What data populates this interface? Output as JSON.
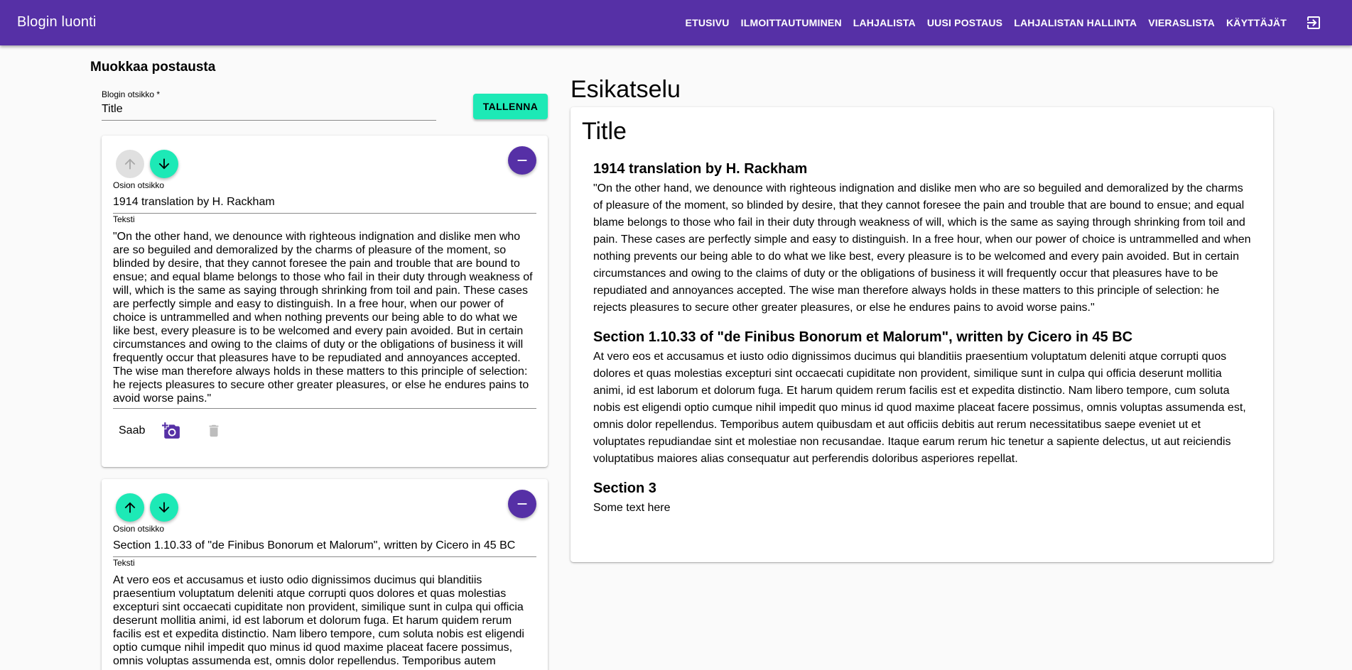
{
  "appbar": {
    "title": "Blogin luonti",
    "nav": [
      "ETUSIVU",
      "ILMOITTAUTUMINEN",
      "LAHJALISTA",
      "UUSI POSTAUS",
      "LAHJALISTAN HALLINTA",
      "VIERASLISTA",
      "KÄYTTÄJÄT"
    ],
    "logout_icon": "logout-icon"
  },
  "editor": {
    "heading": "Muokkaa postausta",
    "title_label": "Blogin otsikko *",
    "title_value": "Title",
    "save_label": "TALLENNA",
    "section_title_label": "Osion otsikko",
    "section_text_label": "Teksti",
    "image_button_label": "Saab",
    "sections": [
      {
        "title": "1914 translation by H. Rackham",
        "text": "\"On the other hand, we denounce with righteous indignation and dislike men who are so beguiled and demoralized by the charms of pleasure of the moment, so blinded by desire, that they cannot foresee the pain and trouble that are bound to ensue; and equal blame belongs to those who fail in their duty through weakness of will, which is the same as saying through shrinking from toil and pain. These cases are perfectly simple and easy to distinguish. In a free hour, when our power of choice is untrammelled and when nothing prevents our being able to do what we like best, every pleasure is to be welcomed and every pain avoided. But in certain circumstances and owing to the claims of duty or the obligations of business it will frequently occur that pleasures have to be repudiated and annoyances accepted. The wise man therefore always holds in these matters to this principle of selection: he rejects pleasures to secure other greater pleasures, or else he endures pains to avoid worse pains.\""
      },
      {
        "title": "Section 1.10.33 of \"de Finibus Bonorum et Malorum\", written by Cicero in 45 BC",
        "text": "At vero eos et accusamus et iusto odio dignissimos ducimus qui blanditiis praesentium voluptatum deleniti atque corrupti quos dolores et quas molestias excepturi sint occaecati cupiditate non provident, similique sunt in culpa qui officia deserunt mollitia animi, id est laborum et dolorum fuga. Et harum quidem rerum facilis est et expedita distinctio. Nam libero tempore, cum soluta nobis est eligendi optio cumque nihil impedit quo minus id quod maxime placeat facere possimus, omnis voluptas assumenda est, omnis dolor repellendus. Temporibus autem"
      }
    ]
  },
  "preview": {
    "heading": "Esikatselu",
    "title": "Title",
    "sections": [
      {
        "title": "1914 translation by H. Rackham",
        "text": "\"On the other hand, we denounce with righteous indignation and dislike men who are so beguiled and demoralized by the charms of pleasure of the moment, so blinded by desire, that they cannot foresee the pain and trouble that are bound to ensue; and equal blame belongs to those who fail in their duty through weakness of will, which is the same as saying through shrinking from toil and pain. These cases are perfectly simple and easy to distinguish. In a free hour, when our power of choice is untrammelled and when nothing prevents our being able to do what we like best, every pleasure is to be welcomed and every pain avoided. But in certain circumstances and owing to the claims of duty or the obligations of business it will frequently occur that pleasures have to be repudiated and annoyances accepted. The wise man therefore always holds in these matters to this principle of selection: he rejects pleasures to secure other greater pleasures, or else he endures pains to avoid worse pains.\""
      },
      {
        "title": "Section 1.10.33 of \"de Finibus Bonorum et Malorum\", written by Cicero in 45 BC",
        "text": "At vero eos et accusamus et iusto odio dignissimos ducimus qui blanditiis praesentium voluptatum deleniti atque corrupti quos dolores et quas molestias excepturi sint occaecati cupiditate non provident, similique sunt in culpa qui officia deserunt mollitia animi, id est laborum et dolorum fuga. Et harum quidem rerum facilis est et expedita distinctio. Nam libero tempore, cum soluta nobis est eligendi optio cumque nihil impedit quo minus id quod maxime placeat facere possimus, omnis voluptas assumenda est, omnis dolor repellendus. Temporibus autem quibusdam et aut officiis debitis aut rerum necessitatibus saepe eveniet ut et voluptates repudiandae sint et molestiae non recusandae. Itaque earum rerum hic tenetur a sapiente delectus, ut aut reiciendis voluptatibus maiores alias consequatur aut perferendis doloribus asperiores repellat."
      },
      {
        "title": "Section 3",
        "text": "Some text here"
      }
    ]
  },
  "colors": {
    "primary": "#5630a6",
    "accent": "#1de9b6",
    "disabled": "#e0e0e0"
  }
}
